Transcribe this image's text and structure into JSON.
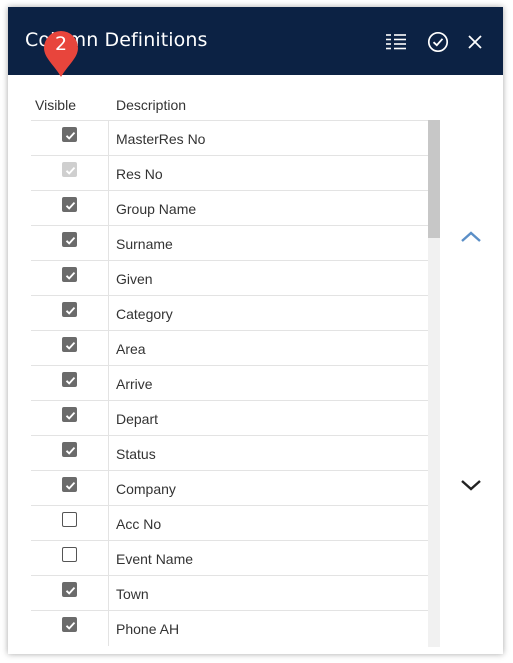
{
  "dialog": {
    "title": "Column Definitions",
    "callout_number": "2",
    "columns": {
      "visible": "Visible",
      "description": "Description"
    },
    "rows": [
      {
        "label": "MasterRes No",
        "visible": true,
        "disabled": false
      },
      {
        "label": "Res No",
        "visible": true,
        "disabled": true
      },
      {
        "label": "Group Name",
        "visible": true,
        "disabled": false
      },
      {
        "label": "Surname",
        "visible": true,
        "disabled": false
      },
      {
        "label": "Given",
        "visible": true,
        "disabled": false
      },
      {
        "label": "Category",
        "visible": true,
        "disabled": false
      },
      {
        "label": "Area",
        "visible": true,
        "disabled": false
      },
      {
        "label": "Arrive",
        "visible": true,
        "disabled": false
      },
      {
        "label": "Depart",
        "visible": true,
        "disabled": false
      },
      {
        "label": "Status",
        "visible": true,
        "disabled": false
      },
      {
        "label": "Company",
        "visible": true,
        "disabled": false
      },
      {
        "label": "Acc No",
        "visible": false,
        "disabled": false
      },
      {
        "label": "Event Name",
        "visible": false,
        "disabled": false
      },
      {
        "label": "Town",
        "visible": true,
        "disabled": false
      },
      {
        "label": "Phone AH",
        "visible": true,
        "disabled": false
      }
    ],
    "icons": {
      "columns": "list-columns-icon",
      "confirm": "check-circle-icon",
      "close": "close-icon",
      "up": "chevron-up-icon",
      "down": "chevron-down-icon"
    },
    "colors": {
      "header": "#0c2244",
      "callout": "#e8453c",
      "arrow_up": "#5b8fc7",
      "arrow_down": "#222222"
    }
  }
}
